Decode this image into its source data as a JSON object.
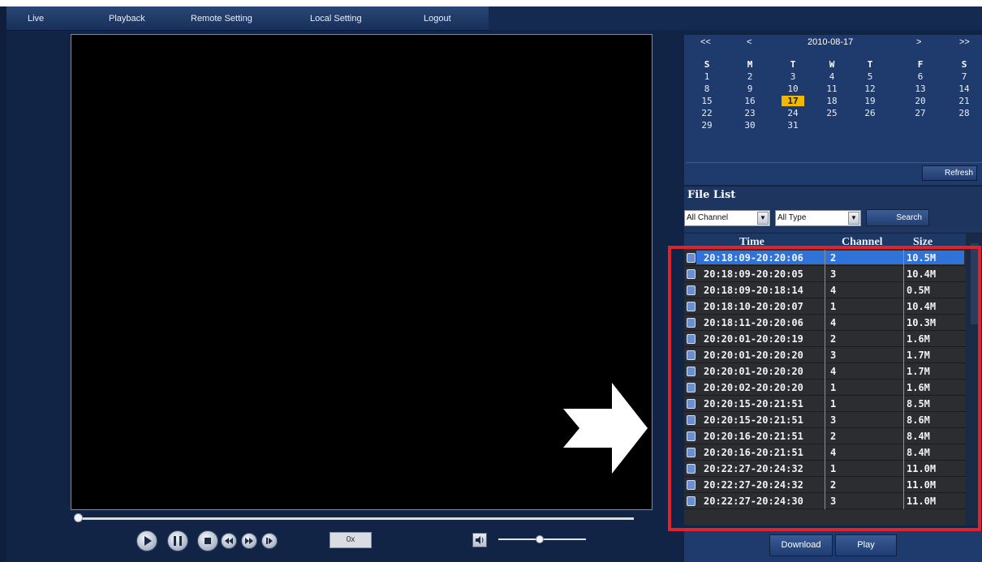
{
  "nav": {
    "items": [
      {
        "label": "Live"
      },
      {
        "label": "Playback"
      },
      {
        "label": "Remote Setting"
      },
      {
        "label": "Local Setting"
      },
      {
        "label": "Logout"
      }
    ]
  },
  "player": {
    "speed": "0x"
  },
  "calendar": {
    "prev_year": "<<",
    "prev_month": "<",
    "date": "2010-08-17",
    "next_month": ">",
    "next_year": ">>",
    "weekdays": [
      "S",
      "M",
      "T",
      "W",
      "T",
      "F",
      "S"
    ],
    "weeks": [
      [
        "1",
        "2",
        "3",
        "4",
        "5",
        "6",
        "7"
      ],
      [
        "8",
        "9",
        "10",
        "11",
        "12",
        "13",
        "14"
      ],
      [
        "15",
        "16",
        "17",
        "18",
        "19",
        "20",
        "21"
      ],
      [
        "22",
        "23",
        "24",
        "25",
        "26",
        "27",
        "28"
      ],
      [
        "29",
        "30",
        "31",
        "",
        "",
        "",
        ""
      ]
    ],
    "selected_day": "17",
    "refresh_label": "Refresh"
  },
  "file_list": {
    "title": "File List",
    "channel_select": "All Channel",
    "type_select": "All Type",
    "search_label": "Search",
    "columns": [
      "Time",
      "Channel",
      "Size"
    ],
    "rows": [
      {
        "time": "20:18:09-20:20:06",
        "channel": "2",
        "size": "10.5M"
      },
      {
        "time": "20:18:09-20:20:05",
        "channel": "3",
        "size": "10.4M"
      },
      {
        "time": "20:18:09-20:18:14",
        "channel": "4",
        "size": "0.5M"
      },
      {
        "time": "20:18:10-20:20:07",
        "channel": "1",
        "size": "10.4M"
      },
      {
        "time": "20:18:11-20:20:06",
        "channel": "4",
        "size": "10.3M"
      },
      {
        "time": "20:20:01-20:20:19",
        "channel": "2",
        "size": "1.6M"
      },
      {
        "time": "20:20:01-20:20:20",
        "channel": "3",
        "size": "1.7M"
      },
      {
        "time": "20:20:01-20:20:20",
        "channel": "4",
        "size": "1.7M"
      },
      {
        "time": "20:20:02-20:20:20",
        "channel": "1",
        "size": "1.6M"
      },
      {
        "time": "20:20:15-20:21:51",
        "channel": "1",
        "size": "8.5M"
      },
      {
        "time": "20:20:15-20:21:51",
        "channel": "3",
        "size": "8.6M"
      },
      {
        "time": "20:20:16-20:21:51",
        "channel": "2",
        "size": "8.4M"
      },
      {
        "time": "20:20:16-20:21:51",
        "channel": "4",
        "size": "8.4M"
      },
      {
        "time": "20:22:27-20:24:32",
        "channel": "1",
        "size": "11.0M"
      },
      {
        "time": "20:22:27-20:24:32",
        "channel": "2",
        "size": "11.0M"
      },
      {
        "time": "20:22:27-20:24:30",
        "channel": "3",
        "size": "11.0M"
      }
    ],
    "selected_row": 0
  },
  "actions": {
    "download_label": "Download",
    "play_label": "Play"
  }
}
